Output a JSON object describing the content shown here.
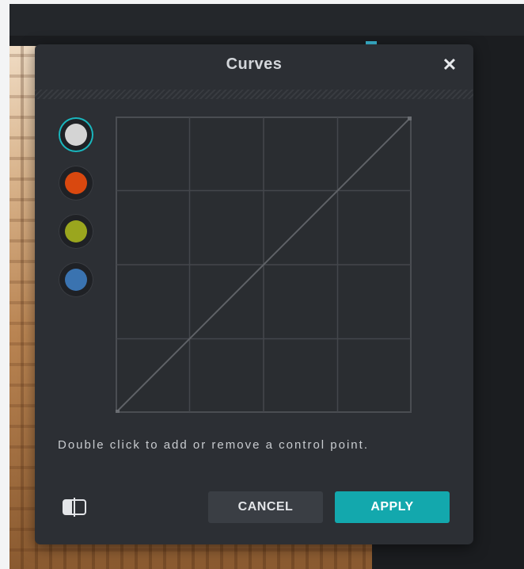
{
  "dialog": {
    "title": "Curves",
    "close_glyph": "✕",
    "hint": "Double click to add or remove a control point.",
    "cancel_label": "CANCEL",
    "apply_label": "APPLY"
  },
  "channels": [
    {
      "name": "rgb",
      "color": "#d4d4d4",
      "active": true
    },
    {
      "name": "red",
      "color": "#d9480f",
      "active": false
    },
    {
      "name": "green",
      "color": "#9aa61e",
      "active": false
    },
    {
      "name": "blue",
      "color": "#3a73b0",
      "active": false
    }
  ],
  "curve": {
    "points": [
      [
        0,
        0
      ],
      [
        255,
        255
      ]
    ]
  },
  "colors": {
    "accent": "#13a8ad",
    "dialog_bg": "#2c2f34"
  },
  "icons": {
    "close": "close-icon",
    "compare": "compare-split-icon"
  }
}
